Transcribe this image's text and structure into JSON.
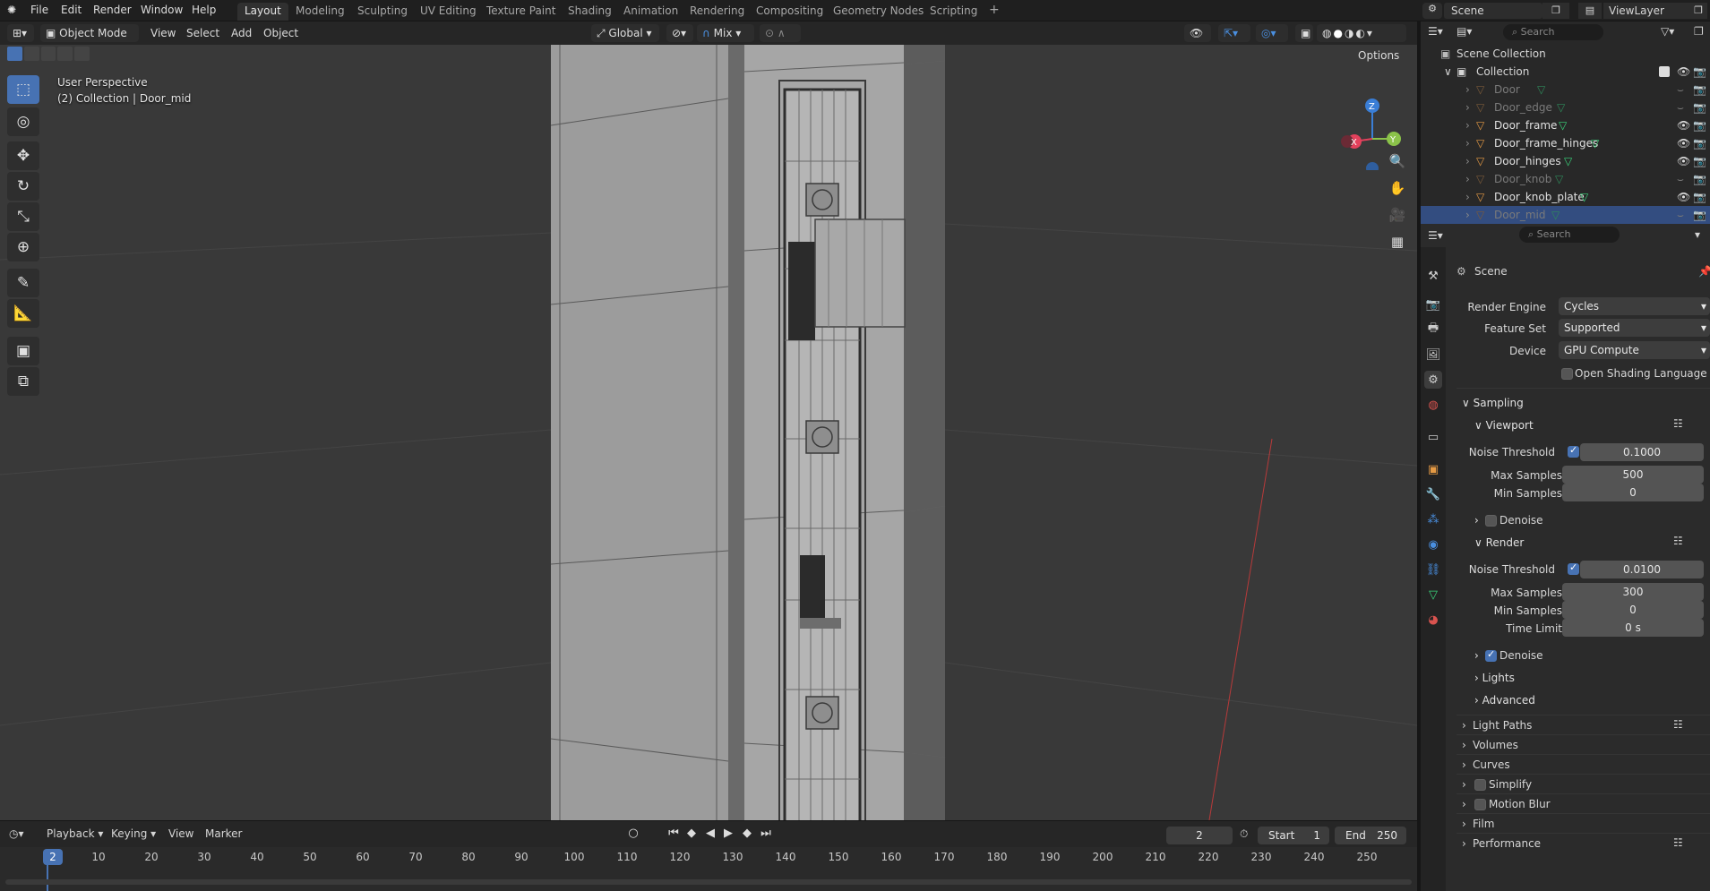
{
  "app": {
    "menus": [
      "File",
      "Edit",
      "Render",
      "Window",
      "Help"
    ],
    "workspaces": [
      "Layout",
      "Modeling",
      "Sculpting",
      "UV Editing",
      "Texture Paint",
      "Shading",
      "Animation",
      "Rendering",
      "Compositing",
      "Geometry Nodes",
      "Scripting"
    ],
    "active_workspace": "Layout",
    "add_workspace": "+",
    "scene": "Scene",
    "view_layer": "ViewLayer"
  },
  "viewport_header": {
    "mode": "Object Mode",
    "menus": [
      "View",
      "Select",
      "Add",
      "Object"
    ],
    "orientation": "Global",
    "snap": "Mix",
    "options": "Options"
  },
  "viewport": {
    "perspective": "User Perspective",
    "collection_info": "(2) Collection | Door_mid",
    "gizmo": {
      "z": "Z",
      "x": "X",
      "y": "Y"
    }
  },
  "outliner": {
    "search_placeholder": "Search",
    "root": "Scene Collection",
    "collection": "Collection",
    "items": [
      {
        "name": "Door",
        "visible": false
      },
      {
        "name": "Door_edge",
        "visible": false
      },
      {
        "name": "Door_frame",
        "visible": true
      },
      {
        "name": "Door_frame_hinges",
        "visible": true
      },
      {
        "name": "Door_hinges",
        "visible": true
      },
      {
        "name": "Door_knob",
        "visible": false
      },
      {
        "name": "Door_knob_plate",
        "visible": true
      },
      {
        "name": "Door_mid",
        "visible": false,
        "selected": true
      }
    ]
  },
  "properties": {
    "search_placeholder": "Search",
    "context": "Scene",
    "render_engine_label": "Render Engine",
    "render_engine": "Cycles",
    "feature_set_label": "Feature Set",
    "feature_set": "Supported",
    "device_label": "Device",
    "device": "GPU Compute",
    "osl_label": "Open Shading Language",
    "sampling": "Sampling",
    "viewport": "Viewport",
    "noise_threshold_label": "Noise Threshold",
    "viewport_noise_threshold": "0.1000",
    "max_samples_label": "Max Samples",
    "viewport_max_samples": "500",
    "min_samples_label": "Min Samples",
    "viewport_min_samples": "0",
    "denoise_label": "Denoise",
    "render": "Render",
    "render_noise_threshold": "0.0100",
    "render_max_samples": "300",
    "render_min_samples": "0",
    "time_limit_label": "Time Limit",
    "time_limit": "0 s",
    "lights": "Lights",
    "advanced": "Advanced",
    "panels": [
      "Light Paths",
      "Volumes",
      "Curves",
      "Simplify",
      "Motion Blur",
      "Film",
      "Performance"
    ]
  },
  "timeline": {
    "menus": [
      "Playback",
      "Keying",
      "View",
      "Marker"
    ],
    "current_frame": "2",
    "start_label": "Start",
    "start": "1",
    "end_label": "End",
    "end": "250",
    "ticks": [
      "2",
      "10",
      "20",
      "30",
      "40",
      "50",
      "60",
      "70",
      "80",
      "90",
      "100",
      "110",
      "120",
      "130",
      "140",
      "150",
      "160",
      "170",
      "180",
      "190",
      "200",
      "210",
      "220",
      "230",
      "240",
      "250"
    ]
  },
  "colors": {
    "accent": "#4772b3",
    "selection_row": "#334d80",
    "axis_x": "#e3415c",
    "axis_y": "#8bc34a",
    "axis_z": "#3a7ed6",
    "mesh_icon": "#3ad37a",
    "object_icon": "#e59a44"
  }
}
